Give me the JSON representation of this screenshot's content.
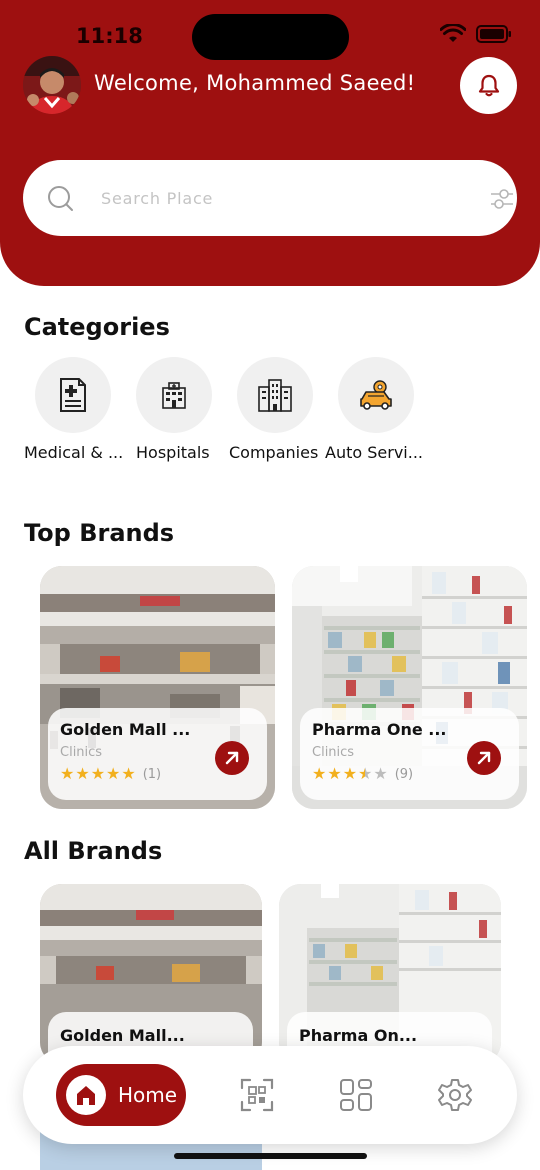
{
  "status": {
    "time": "11:18"
  },
  "header": {
    "welcome": "Welcome, Mohammed Saeed!",
    "bell_icon": "bell-icon"
  },
  "search": {
    "placeholder": "Search Place",
    "search_icon": "search-icon",
    "filter_icon": "filter-sliders-icon"
  },
  "categories": {
    "title": "Categories",
    "items": [
      {
        "label": "Medical & ...",
        "icon": "medical-document-icon"
      },
      {
        "label": "Hospitals",
        "icon": "hospital-building-icon"
      },
      {
        "label": "Companies",
        "icon": "companies-building-icon"
      },
      {
        "label": "Auto Servi...",
        "icon": "car-service-icon"
      }
    ]
  },
  "top_brands": {
    "title": "Top Brands",
    "items": [
      {
        "name": "Golden Mall ...",
        "category": "Clinics",
        "rating": 5,
        "reviews": "(1)",
        "image": "shopping-mall-photo"
      },
      {
        "name": "Pharma One ...",
        "category": "Clinics",
        "rating": 3.5,
        "reviews": "(9)",
        "image": "pharmacy-shelves-photo"
      }
    ]
  },
  "all_brands": {
    "title": "All Brands",
    "items": [
      {
        "name": "Golden Mall...",
        "image": "shopping-mall-photo"
      },
      {
        "name": "Pharma On...",
        "image": "pharmacy-shelves-photo"
      }
    ]
  },
  "nav": {
    "home_label": "Home",
    "items": [
      "home-icon",
      "qr-scan-icon",
      "grid-icon",
      "settings-gear-icon"
    ]
  },
  "colors": {
    "primary": "#9e1010",
    "star": "#f2b01e"
  }
}
